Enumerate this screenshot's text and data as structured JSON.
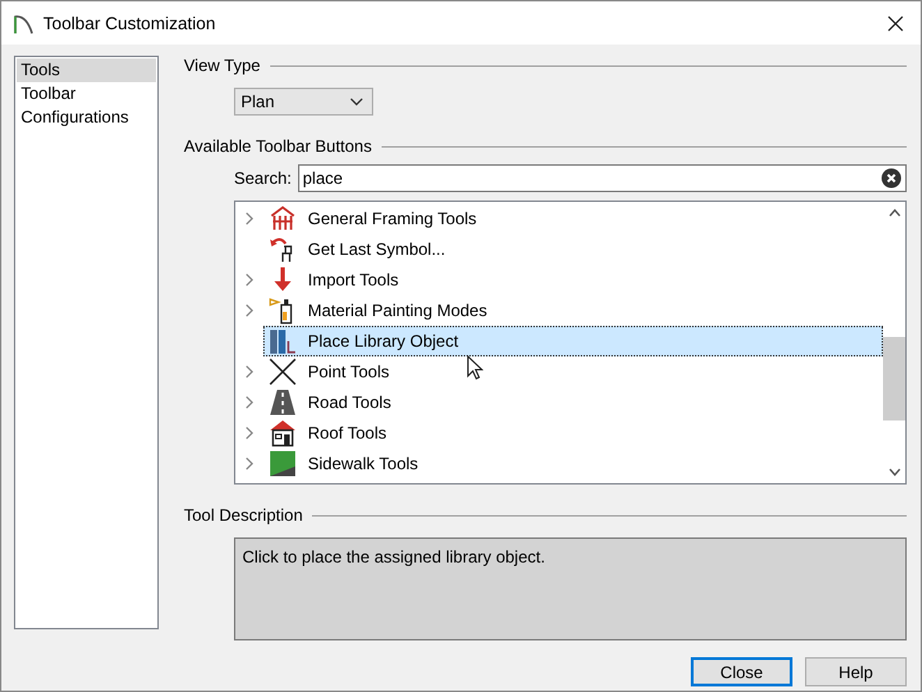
{
  "window": {
    "title": "Toolbar Customization"
  },
  "sidebar": {
    "items": [
      {
        "label": "Tools",
        "selected": true
      },
      {
        "label": "Toolbar",
        "selected": false
      },
      {
        "label": "Configurations",
        "selected": false
      }
    ]
  },
  "view_type": {
    "heading": "View Type",
    "value": "Plan"
  },
  "available_buttons": {
    "heading": "Available Toolbar Buttons",
    "search_label": "Search:",
    "search_value": "place",
    "items": [
      {
        "label": "General Framing Tools",
        "kind": "framing",
        "expandable": true,
        "selected": false
      },
      {
        "label": "Get Last Symbol...",
        "kind": "symbol",
        "expandable": false,
        "selected": false
      },
      {
        "label": "Import Tools",
        "kind": "import",
        "expandable": true,
        "selected": false
      },
      {
        "label": "Material Painting Modes",
        "kind": "paint",
        "expandable": true,
        "selected": false
      },
      {
        "label": "Place Library Object",
        "kind": "library",
        "expandable": false,
        "selected": true
      },
      {
        "label": "Point Tools",
        "kind": "point",
        "expandable": true,
        "selected": false
      },
      {
        "label": "Road Tools",
        "kind": "road",
        "expandable": true,
        "selected": false
      },
      {
        "label": "Roof Tools",
        "kind": "roof",
        "expandable": true,
        "selected": false
      },
      {
        "label": "Sidewalk Tools",
        "kind": "sidewalk",
        "expandable": true,
        "selected": false
      }
    ]
  },
  "tool_description": {
    "heading": "Tool Description",
    "text": "Click to place the assigned library object."
  },
  "buttons": [
    {
      "label": "Close",
      "default": true
    },
    {
      "label": "Help",
      "default": false
    }
  ]
}
